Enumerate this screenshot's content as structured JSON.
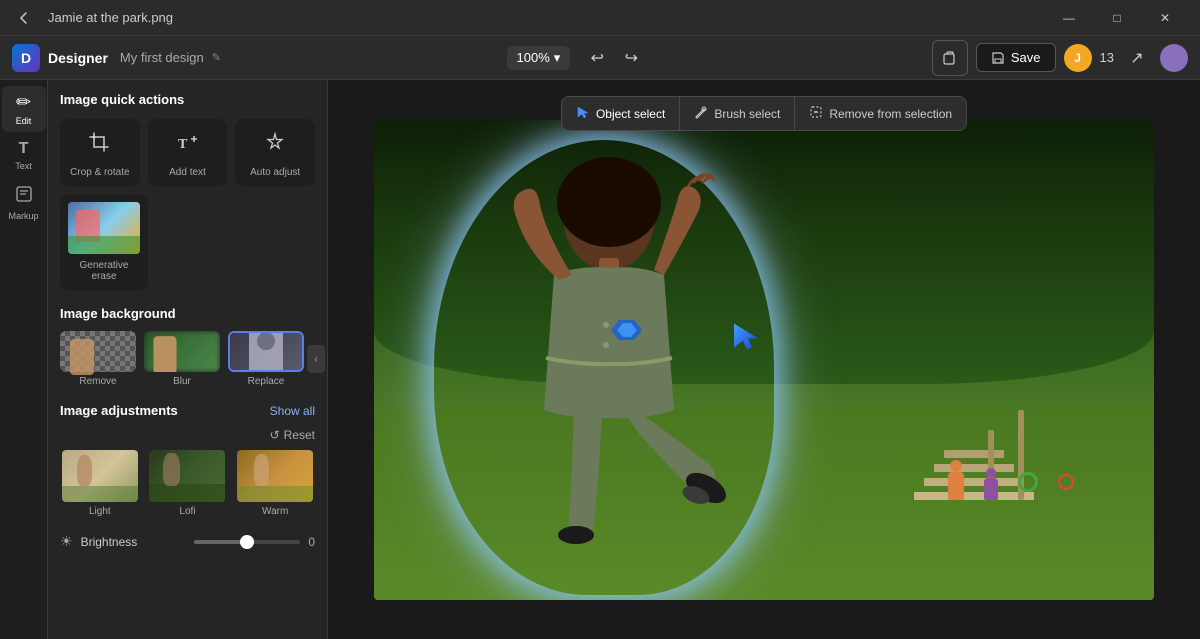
{
  "titlebar": {
    "filename": "Jamie at the park.png",
    "back_icon": "←",
    "minimize": "—",
    "maximize": "□",
    "close": "✕"
  },
  "appbar": {
    "brand": "Designer",
    "design_name": "My first design",
    "save_icon": "✎",
    "zoom": "100%",
    "undo": "↩",
    "redo": "↪",
    "clipboard_icon": "⊡",
    "save_label": "Save",
    "collab_count": "13",
    "share_icon": "↗"
  },
  "icon_strip": {
    "items": [
      {
        "icon": "✏",
        "label": "Edit",
        "active": true
      },
      {
        "icon": "T",
        "label": "Text",
        "active": false
      },
      {
        "icon": "⊞",
        "label": "Markup",
        "active": false
      }
    ]
  },
  "left_panel": {
    "quick_actions_title": "Image quick actions",
    "actions": [
      {
        "icon": "⊙",
        "label": "Crop & rotate"
      },
      {
        "icon": "T+",
        "label": "Add text"
      },
      {
        "icon": "✦",
        "label": "Auto adjust"
      }
    ],
    "gen_erase_label": "Generative erase",
    "image_background_title": "Image background",
    "bg_options": [
      {
        "label": "Remove",
        "type": "checker"
      },
      {
        "label": "Blur",
        "type": "blur"
      },
      {
        "label": "Replace",
        "type": "replace",
        "selected": true
      }
    ],
    "adjustments_title": "Image adjustments",
    "show_all": "Show all",
    "reset": "Reset",
    "filters": [
      {
        "label": "Light",
        "gradient": "linear-gradient(135deg,#c8b89a,#d4c4a8)"
      },
      {
        "label": "Lofi",
        "gradient": "linear-gradient(135deg,#3a5a3a,#2a4a2a)"
      },
      {
        "label": "Warm",
        "gradient": "linear-gradient(135deg,#c8892a,#d4a040)"
      }
    ],
    "brightness_label": "Brightness",
    "brightness_value": "0"
  },
  "selection_toolbar": {
    "tools": [
      {
        "icon": "▶",
        "label": "Object select",
        "active": true
      },
      {
        "icon": "⊹",
        "label": "Brush select",
        "active": false
      },
      {
        "icon": "⊗",
        "label": "Remove from selection",
        "active": false
      }
    ]
  },
  "canvas": {
    "title": "canvas-area"
  }
}
